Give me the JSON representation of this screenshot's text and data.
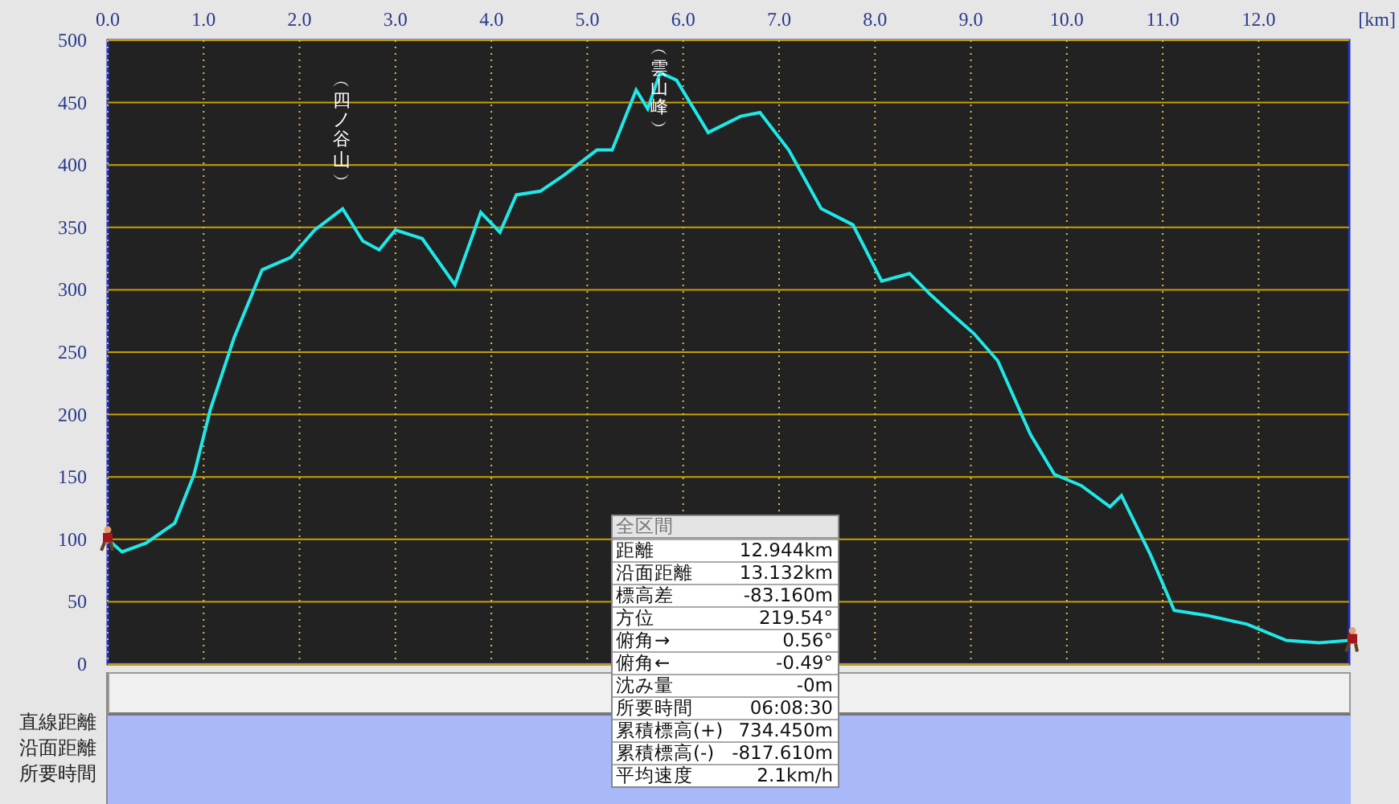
{
  "chart": {
    "chart_data": {
      "type": "line",
      "grid": true,
      "xlabel": "[km]",
      "xlim": [
        0,
        12.944
      ],
      "ylim": [
        0,
        500
      ],
      "xticks": [
        {
          "value": 0,
          "label": "0.0"
        },
        {
          "value": 1,
          "label": "1.0"
        },
        {
          "value": 2,
          "label": "2.0"
        },
        {
          "value": 3,
          "label": "3.0"
        },
        {
          "value": 4,
          "label": "4.0"
        },
        {
          "value": 5,
          "label": "5.0"
        },
        {
          "value": 6,
          "label": "6.0"
        },
        {
          "value": 7,
          "label": "7.0"
        },
        {
          "value": 8,
          "label": "8.0"
        },
        {
          "value": 9,
          "label": "9.0"
        },
        {
          "value": 10,
          "label": "10.0"
        },
        {
          "value": 11,
          "label": "11.0"
        },
        {
          "value": 12,
          "label": "12.0"
        }
      ],
      "yticks": [
        0,
        50,
        100,
        150,
        200,
        250,
        300,
        350,
        400,
        450,
        500
      ],
      "x": [
        0,
        0.15,
        0.4,
        0.7,
        0.9,
        1.07,
        1.32,
        1.61,
        1.91,
        2.16,
        2.45,
        2.66,
        2.83,
        3.0,
        3.28,
        3.62,
        3.89,
        4.09,
        4.26,
        4.51,
        4.76,
        5.1,
        5.26,
        5.51,
        5.63,
        5.76,
        5.93,
        6.26,
        6.6,
        6.8,
        7.1,
        7.44,
        7.77,
        8.07,
        8.36,
        8.58,
        8.78,
        9.03,
        9.28,
        9.62,
        9.87,
        10.15,
        10.45,
        10.57,
        10.87,
        11.12,
        11.46,
        11.88,
        12.29,
        12.63,
        12.944
      ],
      "series": [
        {
          "color": "#20e8e8",
          "values": [
            100,
            90,
            97,
            113,
            152,
            204,
            262,
            316,
            326,
            348,
            365,
            339,
            332,
            348,
            341,
            304,
            362,
            346,
            376,
            379,
            392,
            412,
            412,
            460,
            445,
            474,
            468,
            426,
            439,
            442,
            412,
            365,
            352,
            307,
            313,
            296,
            282,
            265,
            243,
            184,
            152,
            143,
            126,
            135,
            88,
            43,
            39,
            32,
            19,
            17,
            19
          ]
        }
      ],
      "annotations": [
        {
          "x": 2.45,
          "y": 365,
          "text": "︵四ノ谷山︶"
        },
        {
          "x": 5.76,
          "y": 474,
          "text": "︵雲山峰︶"
        }
      ]
    }
  },
  "info_panel": {
    "title": "全区間",
    "rows": [
      {
        "label": "距離",
        "value": "12.944km"
      },
      {
        "label": "沿面距離",
        "value": "13.132km"
      },
      {
        "label": "標高差",
        "value": "-83.160m"
      },
      {
        "label": "方位",
        "value": "219.54°"
      },
      {
        "label": "俯角→",
        "value": "0.56°"
      },
      {
        "label": "俯角←",
        "value": "-0.49°"
      },
      {
        "label": "沈み量",
        "value": "-0m"
      },
      {
        "label": "所要時間",
        "value": "06:08:30"
      },
      {
        "label": "累積標高(+)",
        "value": "734.450m"
      },
      {
        "label": "累積標高(-)",
        "value": "-817.610m"
      },
      {
        "label": "平均速度",
        "value": "2.1km/h"
      }
    ]
  },
  "side_labels": [
    "直線距離",
    "沿面距離",
    "所要時間"
  ]
}
